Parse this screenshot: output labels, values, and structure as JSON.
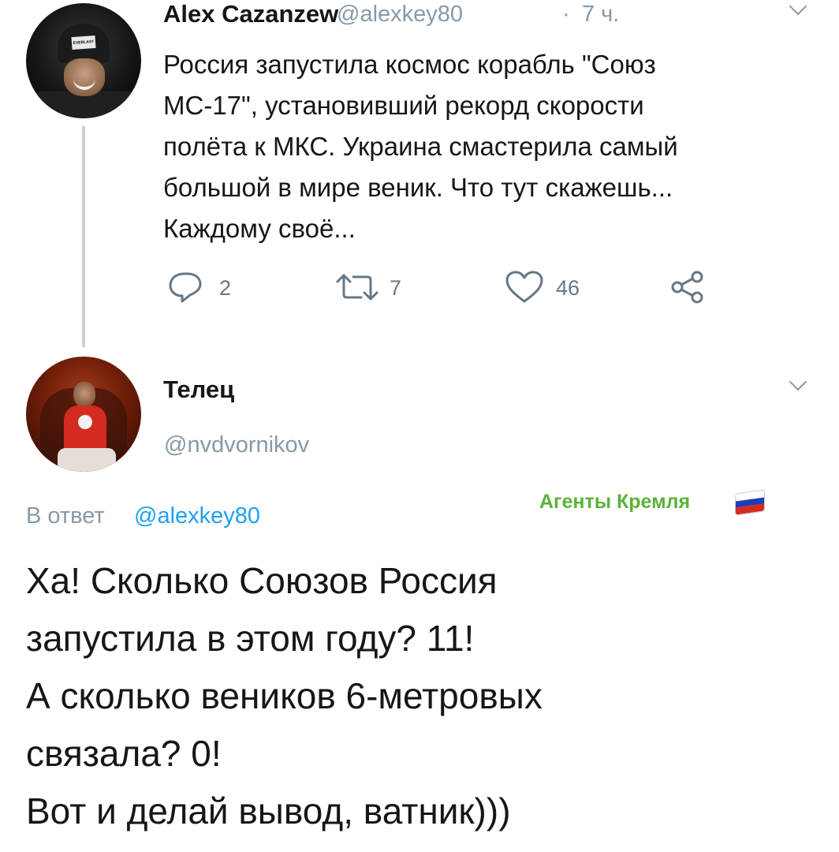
{
  "tweet": {
    "author_name": "Alex Cazanzew",
    "author_handle": "@alexkey80",
    "separator": "·",
    "time": "7 ч.",
    "text_lines": [
      "Россия запустила космос корабль \"Союз",
      "МС-17\", установивший рекорд скорости",
      "полёта к МКС. Украина смастерила самый",
      "большой в мире веник. Что тут скажешь...",
      "Каждому своё..."
    ],
    "avatar_hat_text": "EVERLAST",
    "actions": {
      "replies": "2",
      "retweets": "7",
      "likes": "46"
    }
  },
  "reply": {
    "author_name": "Телец",
    "author_handle": "@nvdvornikov",
    "reply_to_prefix": "В ответ",
    "reply_to_handle": "@alexkey80",
    "text_lines": [
      "Ха! Сколько Союзов Россия",
      "запустила в этом году? 11!",
      "А сколько веников 6-метровых",
      "связала? 0!",
      "Вот и делай вывод, ватник)))"
    ]
  },
  "watermark": {
    "text": "Агенты Кремля",
    "flag_colors": [
      "#ffffff",
      "#1c3fb4",
      "#d52b1e"
    ]
  },
  "colors": {
    "text_primary": "#14171a",
    "text_secondary": "#8899a6",
    "link": "#1da1f2",
    "watermark": "#59b33a",
    "thread_line": "#c8d0d6"
  },
  "icons": [
    "reply-icon",
    "retweet-icon",
    "like-icon",
    "share-icon",
    "chevron-down-icon"
  ]
}
